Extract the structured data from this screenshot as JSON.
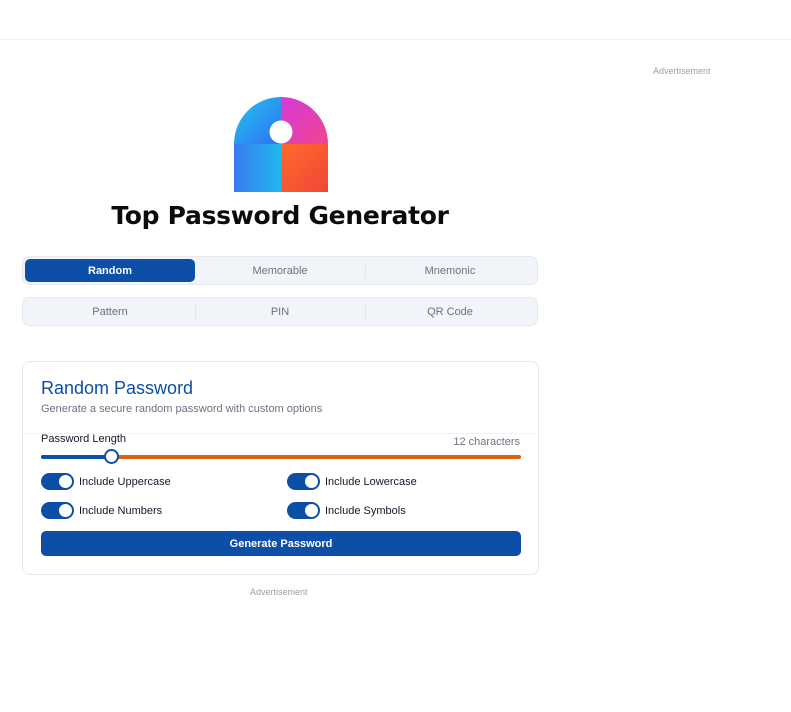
{
  "ads": {
    "right_label": "Advertisement",
    "bottom_label": "Advertisement"
  },
  "logo": {
    "icon": "padlock-logo-icon"
  },
  "page_title": "Top Password Generator",
  "tabs": {
    "row1": [
      {
        "label": "Random",
        "active": true
      },
      {
        "label": "Memorable",
        "active": false
      },
      {
        "label": "Mnemonic",
        "active": false
      }
    ],
    "row2": [
      {
        "label": "Pattern",
        "active": false
      },
      {
        "label": "PIN",
        "active": false
      },
      {
        "label": "QR Code",
        "active": false
      }
    ]
  },
  "card": {
    "title": "Random Password",
    "subtitle": "Generate a secure random password with custom options",
    "length": {
      "label": "Password Length",
      "value_text": "12 characters",
      "fraction": 0.146
    },
    "options": [
      {
        "label": "Include Uppercase",
        "checked": true
      },
      {
        "label": "Include Lowercase",
        "checked": true
      },
      {
        "label": "Include Numbers",
        "checked": true
      },
      {
        "label": "Include Symbols",
        "checked": true
      }
    ],
    "generate_label": "Generate Password"
  },
  "colors": {
    "primary": "#0d4ea6",
    "slider_track": "#dd5f0f"
  }
}
